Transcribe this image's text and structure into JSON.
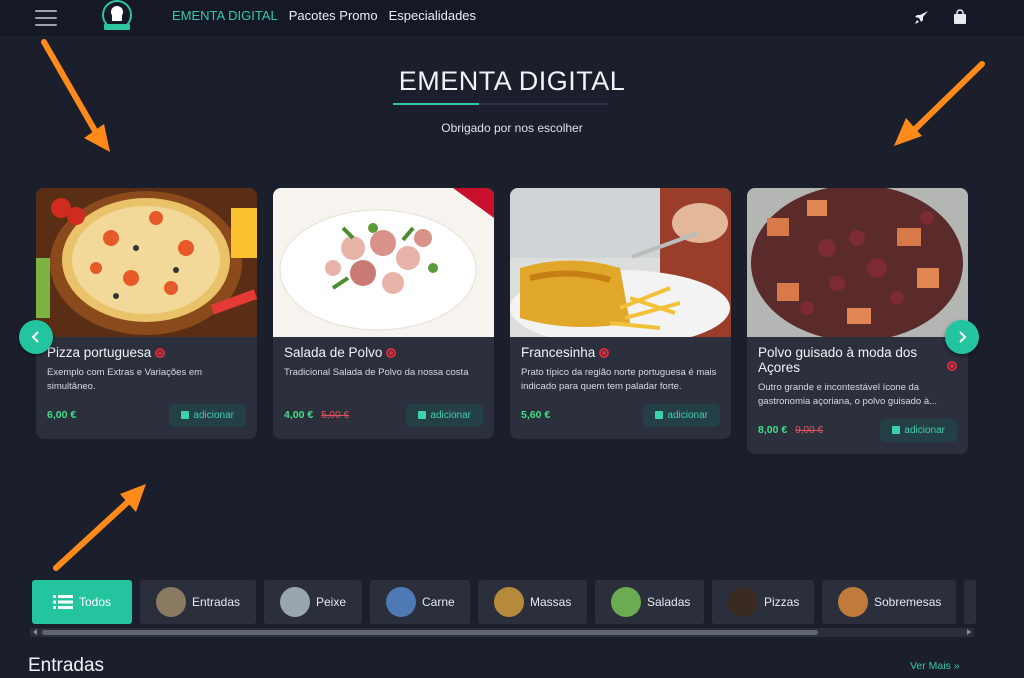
{
  "nav": {
    "items": [
      {
        "label": "EMENTA DIGITAL",
        "active": true
      },
      {
        "label": "Pacotes Promo",
        "active": false
      },
      {
        "label": "Especialidades",
        "active": false
      }
    ],
    "icons": [
      "menu-icon",
      "rocket-icon",
      "shopping-bag-icon"
    ]
  },
  "hero": {
    "title": "EMENTA DIGITAL",
    "subtitle": "Obrigado por nos escolher"
  },
  "cards": [
    {
      "name": "Pizza portuguesa",
      "description": "Exemplo com Extras e Variações em simultâneo.",
      "price": "6,00 €",
      "old_price": "",
      "button": "adicionar"
    },
    {
      "name": "Salada de Polvo",
      "description": "Tradicional Salada de Polvo da nossa costa",
      "price": "4,00 €",
      "old_price": "5,00 €",
      "button": "adicionar"
    },
    {
      "name": "Francesinha",
      "description": "Prato típico da região norte portuguesa é mais indicado para quem tem paladar forte.",
      "price": "5,60 €",
      "old_price": "",
      "button": "adicionar"
    },
    {
      "name": "Polvo guisado à moda dos Açores",
      "description": "Outro grande e incontestável ícone da gastronomia açoriana, o polvo guisado à...",
      "price": "8,00 €",
      "old_price": "9,00 €",
      "button": "adicionar"
    }
  ],
  "categories": [
    {
      "label": "Todos",
      "active": true
    },
    {
      "label": "Entradas",
      "active": false
    },
    {
      "label": "Peixe",
      "active": false
    },
    {
      "label": "Carne",
      "active": false
    },
    {
      "label": "Massas",
      "active": false
    },
    {
      "label": "Saladas",
      "active": false
    },
    {
      "label": "Pizzas",
      "active": false
    },
    {
      "label": "Sobremesas",
      "active": false
    }
  ],
  "section": {
    "title": "Entradas",
    "more": "Ver Mais »"
  },
  "colors": {
    "accent": "#33c9a8",
    "background": "#1b1f2b",
    "price": "#3ee08a",
    "old_price": "#e2545d",
    "annotation_arrow": "#ff8a1c"
  }
}
